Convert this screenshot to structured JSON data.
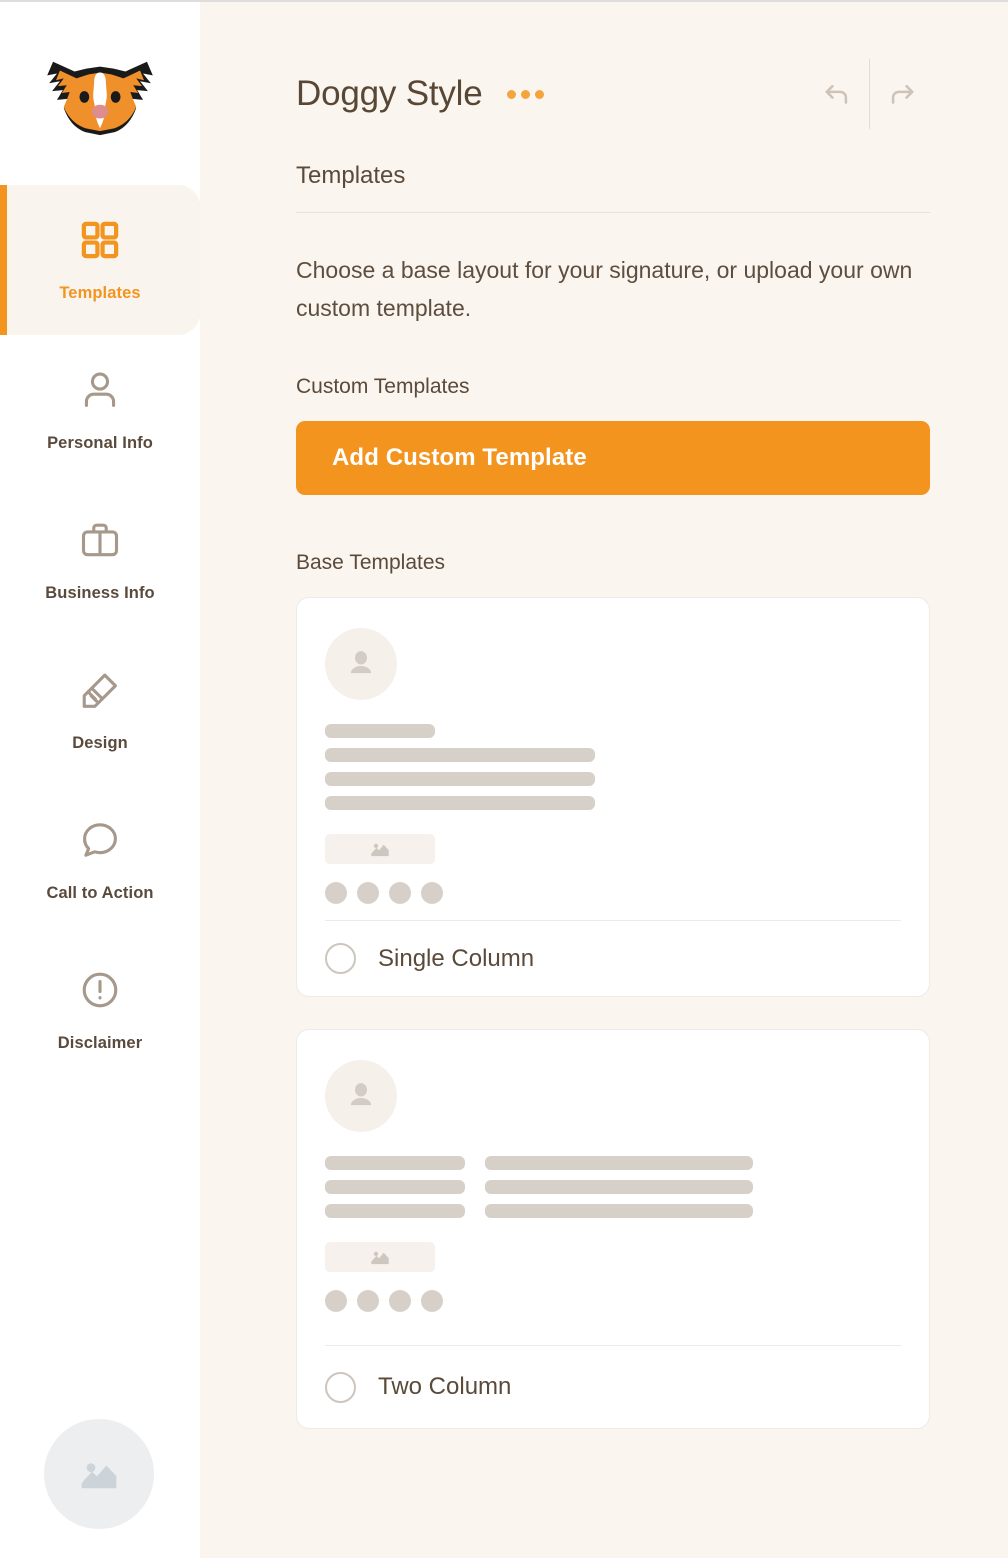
{
  "app": {
    "logo_icon": "dog-face-logo",
    "accent_color": "#F2941E",
    "background_color": "#FBF5F0",
    "sidebar_background": "#FFFFFF",
    "text_color": "#5A4A3A"
  },
  "sidebar": {
    "items": [
      {
        "label": "Templates",
        "icon": "grid-icon",
        "active": true
      },
      {
        "label": "Personal Info",
        "icon": "person-icon",
        "active": false
      },
      {
        "label": "Business Info",
        "icon": "briefcase-icon",
        "active": false
      },
      {
        "label": "Design",
        "icon": "paintbrush-icon",
        "active": false
      },
      {
        "label": "Call to Action",
        "icon": "chat-bubble-icon",
        "active": false
      },
      {
        "label": "Disclaimer",
        "icon": "alert-circle-icon",
        "active": false
      }
    ],
    "footer": {
      "icon": "image-placeholder-icon"
    }
  },
  "header": {
    "document_title": "Doggy Style",
    "menu_icon": "three-dots-icon",
    "undo_icon": "undo-arrow-icon",
    "redo_icon": "redo-arrow-icon"
  },
  "main": {
    "section_title": "Templates",
    "intro": "Choose a base layout for your signature, or upload your own custom template.",
    "custom_templates_heading": "Custom Templates",
    "add_custom_template_label": "Add Custom Template",
    "base_templates_heading": "Base Templates",
    "templates": [
      {
        "name": "Single Column",
        "layout": "single",
        "selected": false,
        "preview": {
          "avatar_icon": "person-avatar-icon",
          "image_icon": "image-placeholder-icon",
          "social_dots": 4
        }
      },
      {
        "name": "Two Column",
        "layout": "two",
        "selected": false,
        "preview": {
          "avatar_icon": "person-avatar-icon",
          "image_icon": "image-placeholder-icon",
          "social_dots": 4
        }
      }
    ]
  }
}
